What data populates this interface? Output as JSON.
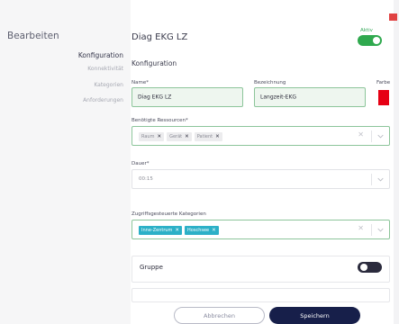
{
  "sidebar": {
    "title": "Bearbeiten",
    "items": [
      {
        "label": "Konfiguration",
        "active": true
      },
      {
        "label": "Konnektivität",
        "active": false
      },
      {
        "label": "Kategorien",
        "active": false
      },
      {
        "label": "Anforderungen",
        "active": false
      }
    ]
  },
  "header": {
    "title": "Diag EKG LZ",
    "section": "Konfiguration",
    "active_label": "Aktiv",
    "active_state": true
  },
  "fields": {
    "name": {
      "label": "Name*",
      "value": "Diag EKG LZ"
    },
    "bezeichnung": {
      "label": "Bezeichnung",
      "value": "Langzeit-EKG"
    },
    "farbe": {
      "label": "Farbe",
      "value": "#e60014"
    },
    "ressourcen": {
      "label": "Benötigte Ressourcen*",
      "chips": [
        "Raum",
        "Gerät",
        "Patient"
      ]
    },
    "dauer": {
      "label": "Dauer*",
      "value": "00:15"
    },
    "kategorien": {
      "label": "Zugriffsgesteuerte Kategorien",
      "chips": [
        "Inne-Zentrum",
        "Hoschsee"
      ]
    }
  },
  "gruppe": {
    "label": "Gruppe",
    "state": false
  },
  "buttons": {
    "cancel": "Abbrechen",
    "save": "Speichern"
  },
  "colors": {
    "accent_green": "#2fa94e",
    "chip_blue": "#2cb0c7",
    "primary_navy": "#171f4a",
    "danger_red": "#e04242"
  }
}
